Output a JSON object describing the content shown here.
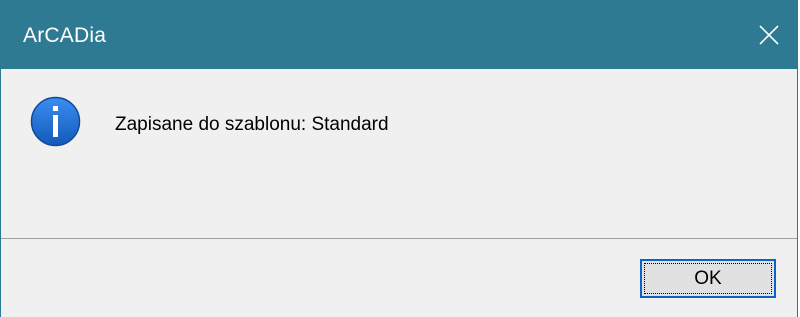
{
  "dialog": {
    "title": "ArCADia",
    "message": "Zapisane do szablonu: Standard",
    "icon": "info-icon",
    "ok_label": "OK",
    "close_icon": "close-icon"
  },
  "colors": {
    "titlebar": "#2e7a93",
    "title_text": "#ffffff",
    "icon_fill": "#1c6fd1",
    "body_bg": "#f0f0f0",
    "button_border": "#0a64c8"
  }
}
